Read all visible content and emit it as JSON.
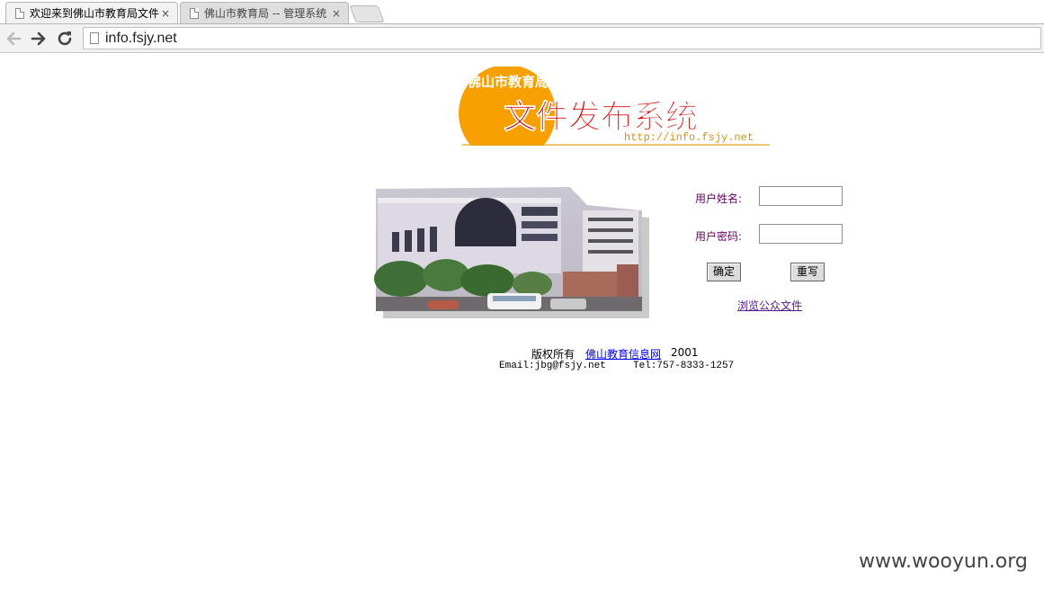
{
  "browser": {
    "tabs": [
      {
        "title": "欢迎来到佛山市教育局文件",
        "active": true
      },
      {
        "title": "佛山市教育局 -- 管理系统",
        "active": false
      }
    ],
    "close_glyph": "×",
    "url": "info.fsjy.net",
    "nav_icons": {
      "back": "arrow-left-icon",
      "forward": "arrow-right-icon",
      "reload": "reload-icon"
    }
  },
  "logo": {
    "org": "佛山市教育局",
    "system": "文件发布系统",
    "url": "http://info.fsjy.net",
    "sun_color": "#f7a000",
    "title_color": "#d40000"
  },
  "login": {
    "username_label": "用户姓名:",
    "password_label": "用户密码:",
    "username_value": "",
    "password_value": "",
    "submit_label": "确定",
    "reset_label": "重写",
    "public_docs_link": "浏览公众文件"
  },
  "footer": {
    "copyright_prefix": "版权所有",
    "site_link": "佛山教育信息网",
    "year": "2001",
    "email": "Email:jbg@fsjy.net",
    "tel": "Tel:757-8333-1257"
  },
  "watermark": "www.wooyun.org"
}
